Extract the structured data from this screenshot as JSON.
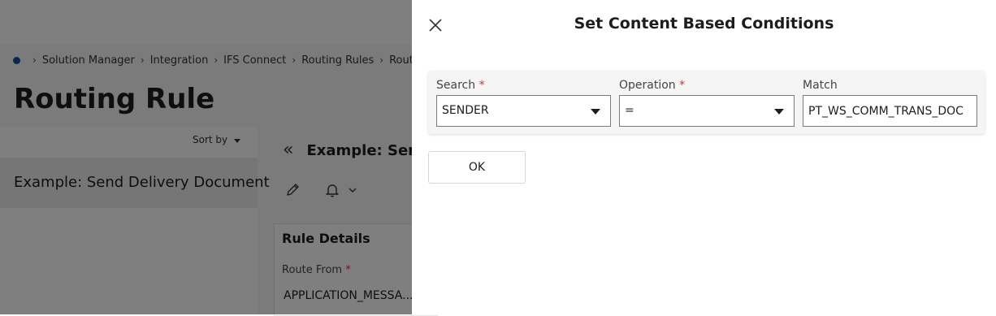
{
  "background": {
    "breadcrumb": [
      "Solution Manager",
      "Integration",
      "IFS Connect",
      "Routing Rules",
      "Routing"
    ],
    "page_title": "Routing Rule",
    "sort_label": "Sort by",
    "list_items": [
      "Example: Send Delivery Document"
    ],
    "detail_title": "Example: Send",
    "card": {
      "title": "Rule Details",
      "route_from_label": "Route From",
      "route_from_value": "APPLICATION_MESSA..."
    }
  },
  "dialog": {
    "title": "Set Content Based Conditions",
    "search": {
      "label": "Search",
      "value": "SENDER"
    },
    "operation": {
      "label": "Operation",
      "value": "="
    },
    "match": {
      "label": "Match",
      "value": "PT_WS_COMM_TRANS_DOC"
    },
    "ok_label": "OK",
    "required_mark": "*"
  },
  "icons": [
    "home-icon",
    "chevron-right-icon",
    "caret-down-icon",
    "double-chevron-left-icon",
    "pencil-icon",
    "bell-icon",
    "chevron-down-icon",
    "close-icon",
    "dropdown-arrow-icon"
  ],
  "colors": {
    "accent": "#0b5394",
    "required": "#d13438",
    "overlay": "#000000"
  }
}
